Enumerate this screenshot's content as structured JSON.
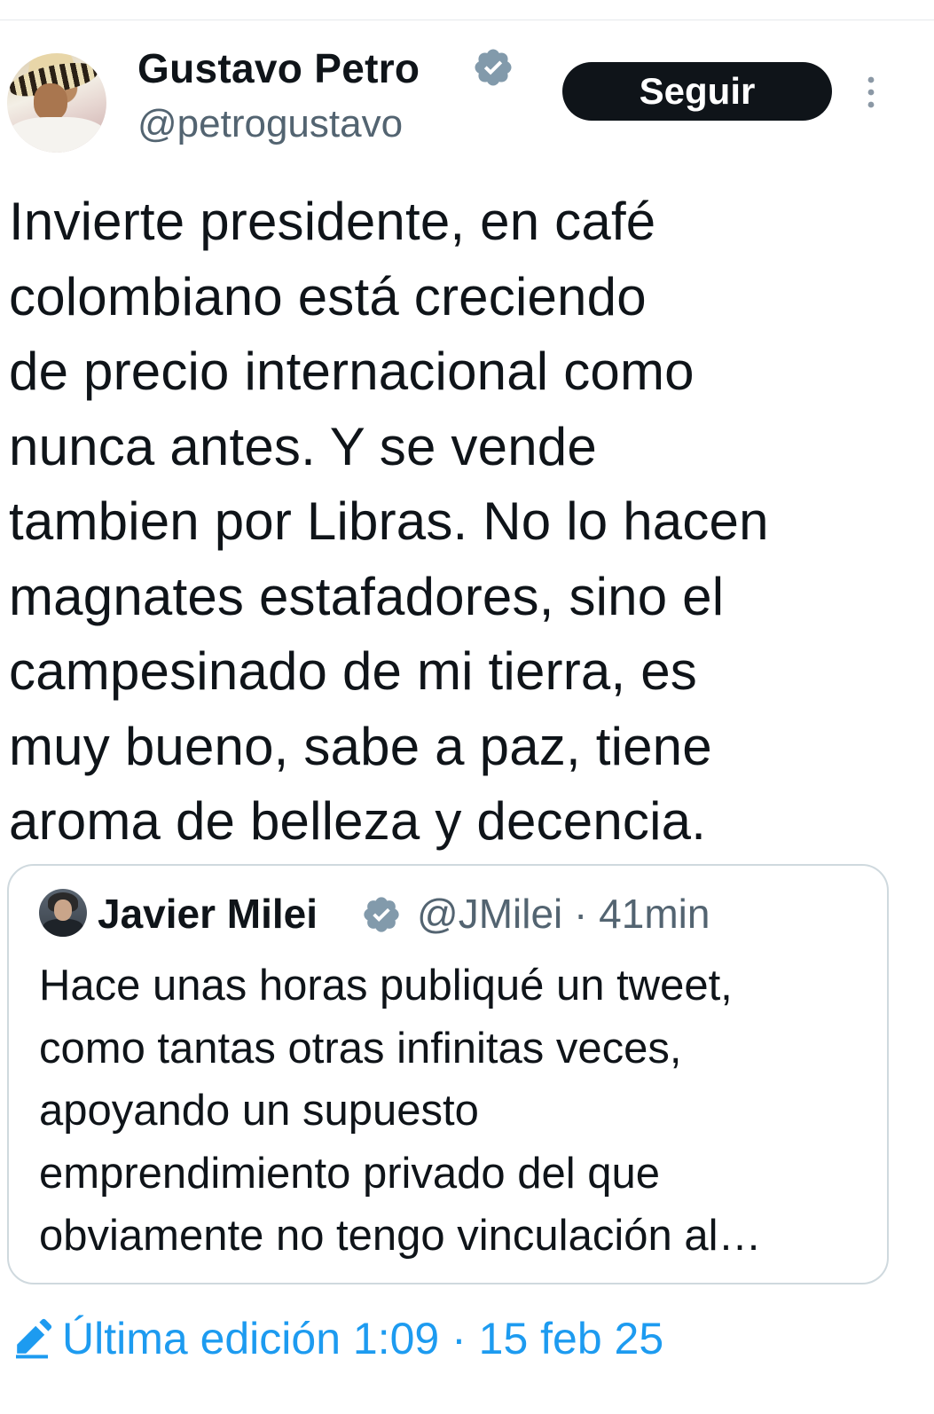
{
  "tweet": {
    "author": {
      "display_name": "Gustavo Petro",
      "handle": "@petrogustavo",
      "verified": true
    },
    "follow_label": "Seguir",
    "text": "Invierte presidente, en café\ncolombiano está creciendo\nde precio internacional como\nnunca antes. Y se vende\ntambien por Libras. No lo hacen\nmagnates estafadores, sino el\ncampesinado de mi tierra, es\nmuy bueno, sabe a paz, tiene\naroma de belleza y decencia.",
    "quoted": {
      "display_name": "Javier Milei",
      "handle": "@JMilei",
      "separator": "·",
      "time": "41min",
      "text": "Hace unas horas publiqué un tweet,\ncomo tantas otras infinitas veces,\napoyando un supuesto\nemprendimiento privado del que\nobviamente no tengo vinculación al…"
    },
    "edit_info": "Última edición 1:09 · 15 feb 25"
  },
  "icons": {
    "verified": "verified-badge-icon",
    "more": "more-vertical-icon",
    "edit": "pencil-edit-icon"
  },
  "colors": {
    "text": "#0f1419",
    "secondary": "#536471",
    "accent": "#1d9bf0",
    "button_bg": "#0f1419",
    "border": "#cfd9de"
  }
}
